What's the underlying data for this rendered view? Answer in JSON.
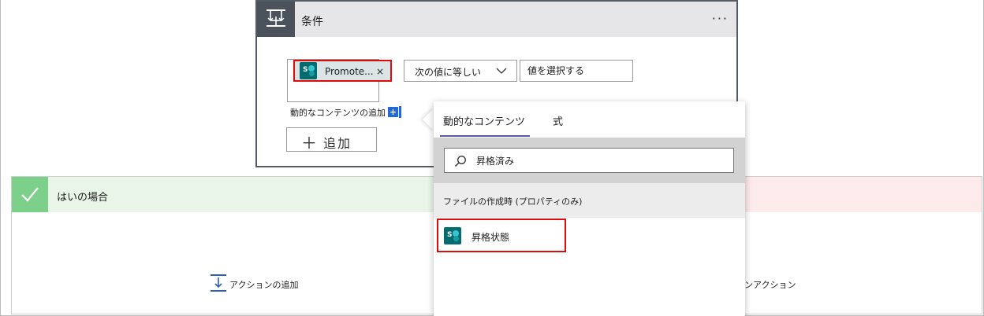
{
  "condition": {
    "title": "条件",
    "more_label": "···",
    "token_label": "Promote...",
    "token_close": "×",
    "operator": "次の値に等しい",
    "value_placeholder": "値を選択する",
    "dynamic_content_link": "動的なコンテンツの追加",
    "dynamic_content_plus": "+",
    "add_plus": "＋",
    "add_label": "追加"
  },
  "popup": {
    "tabs": [
      "動的なコンテンツ",
      "式"
    ],
    "active_tab": 0,
    "search_value": "昇格済み",
    "section_header": "ファイルの作成時 (プロパティのみ)",
    "results": [
      {
        "label": "昇格状態",
        "icon": "sharepoint-icon"
      }
    ]
  },
  "yes_branch": {
    "title": "はいの場合",
    "add_action_label": "アクションの追加"
  },
  "no_branch": {
    "add_action_label": "ンアクション"
  },
  "colors": {
    "condition_header_bg": "#e6e6e9",
    "condition_icon_bg": "#4b525c",
    "highlight_border": "#e00c0c",
    "sharepoint_icon": "#036c70",
    "yes_header_bg": "#e8f5e8",
    "yes_check_bg": "#7cd089",
    "no_header_bg": "#fdeaea",
    "tab_underline": "#5d5aa8",
    "dynamic_plus": "#2168d9"
  }
}
